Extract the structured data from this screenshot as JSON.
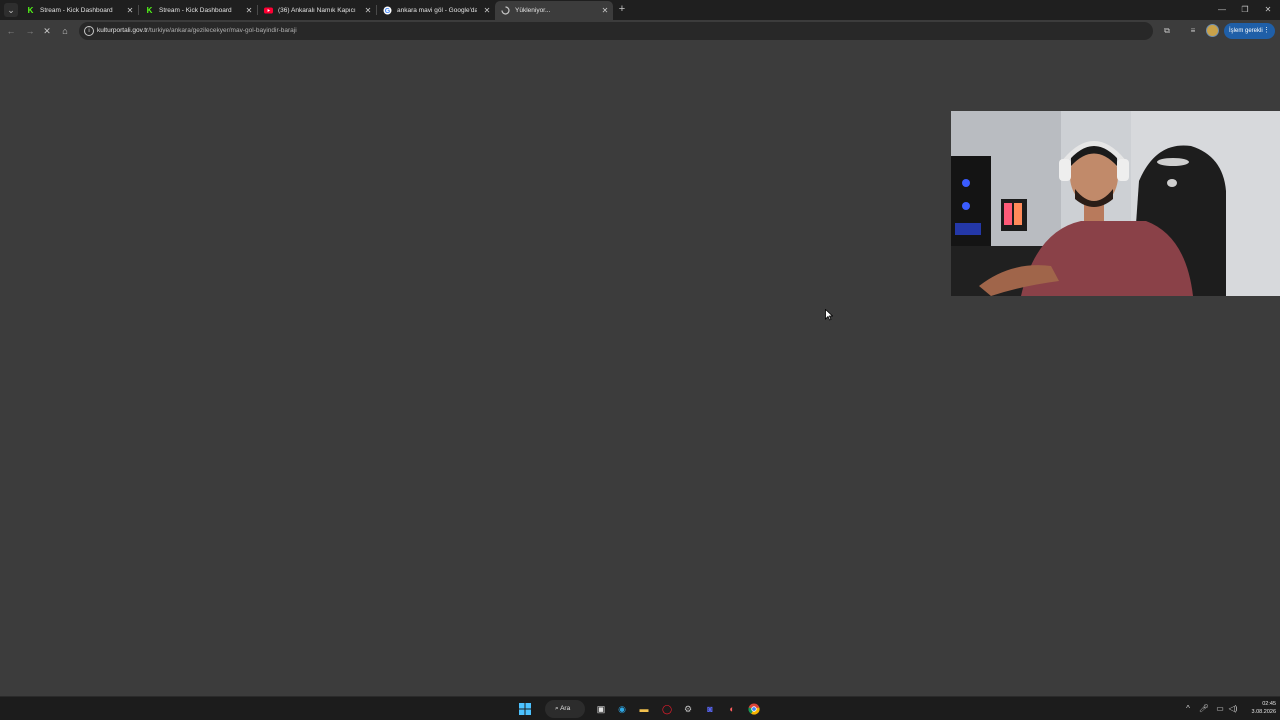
{
  "tabs": [
    {
      "title": "Stream - Kick Dashboard",
      "icon": "kick-icon",
      "color": "#53fc18"
    },
    {
      "title": "Stream - Kick Dashboard",
      "icon": "kick-icon",
      "color": "#53fc18"
    },
    {
      "title": "(36) Ankaralı Namık Kapıcı İzzet",
      "icon": "youtube-icon",
      "color": "#ff0033"
    },
    {
      "title": "ankara mavi göl - Google'da Ara",
      "icon": "google-icon",
      "color": "#4285f4"
    },
    {
      "title": "Yükleniyor...",
      "icon": "loading-icon",
      "color": "#c7c7c7"
    }
  ],
  "address_bar": {
    "host": "kulturportali.gov.tr",
    "path": "/turkiye/ankara/gezilecekyer/mav-gol-bayindir-baraji"
  },
  "toolbar": {
    "action_label": "İşlem gerekli"
  },
  "taskbar": {
    "search_label": "Ara",
    "time": "02:45",
    "date": "3.08.2026"
  },
  "colors": {
    "accent": "#1f5fa8",
    "page_bg": "#3c3c3c",
    "tabbar_bg": "#1f1f1f"
  }
}
